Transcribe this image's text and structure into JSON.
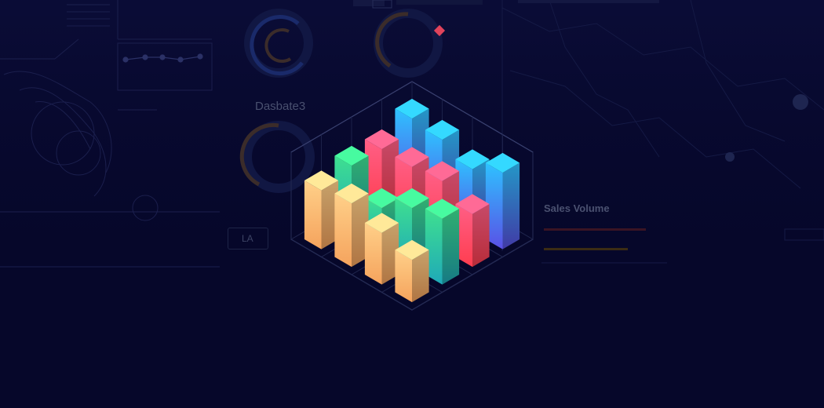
{
  "background": {
    "color": "#06072a",
    "panel_title": "Dasbate3",
    "panel_subtitle": "Sales Volume",
    "button_label": "LA",
    "accent_marker_color": "#e0435b"
  },
  "chart_data": {
    "type": "bar",
    "style": "3d-isometric",
    "title": "",
    "grid": true,
    "rows": [
      {
        "color_top": "#ffd089",
        "color_bottom": "#f5a35d",
        "values": [
          3.6,
          4.4,
          5.4,
          5.0
        ]
      },
      {
        "color_top": "#3fe08f",
        "color_bottom": "#1fa9b8",
        "values": [
          5.6,
          5.0,
          3.5,
          5.6
        ]
      },
      {
        "color_top": "#ff5f86",
        "color_bottom": "#ff3d4f",
        "values": [
          4.5,
          5.8,
          5.5,
          5.5
        ]
      },
      {
        "color_top": "#2ec2ff",
        "color_bottom": "#5a50e6",
        "values": [
          6.5,
          5.3,
          6.3,
          6.6
        ]
      }
    ]
  }
}
